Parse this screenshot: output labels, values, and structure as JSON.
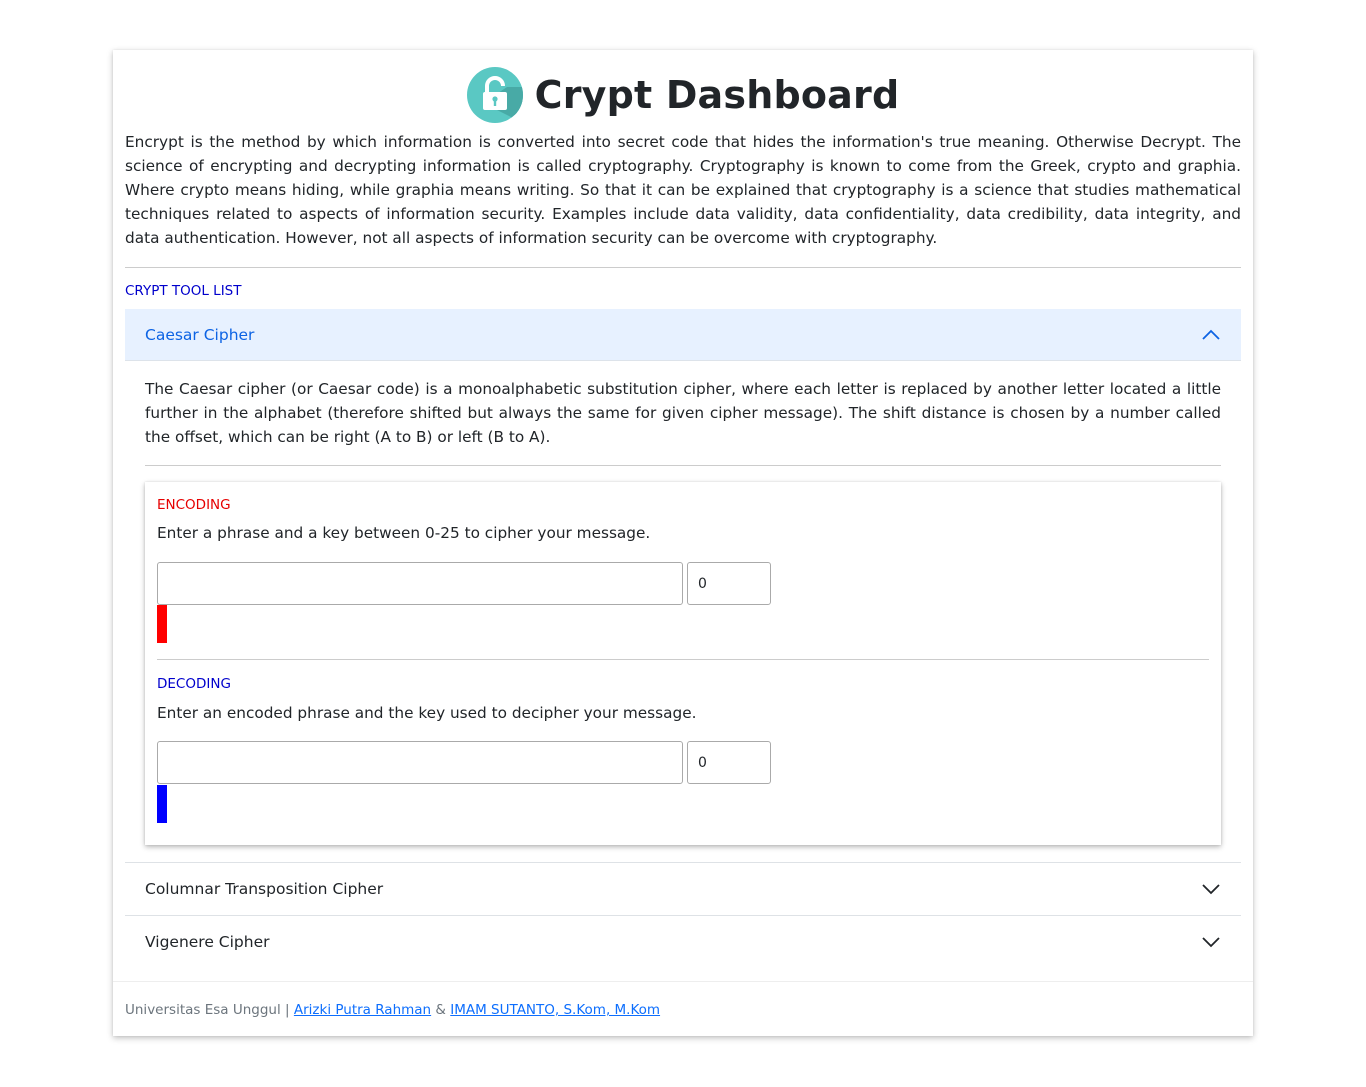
{
  "header": {
    "title": "Crypt Dashboard",
    "logo_icon": "padlock-icon",
    "logo_color": "#5ac8c3"
  },
  "intro": "Encrypt is the method by which information is converted into secret code that hides the information's true meaning. Otherwise Decrypt. The science of encrypting and decrypting information is called cryptography. Cryptography is known to come from the Greek, crypto and graphia. Where crypto means hiding, while graphia means writing. So that it can be explained that cryptography is a science that studies mathematical techniques related to aspects of information security. Examples include data validity, data confidentiality, data credibility, data integrity, and data authentication. However, not all aspects of information security can be overcome with cryptography.",
  "tool_list_label": "CRYPT TOOL LIST",
  "accordion": {
    "caesar": {
      "title": "Caesar Cipher",
      "expanded": true,
      "description": "The Caesar cipher (or Caesar code) is a monoalphabetic substitution cipher, where each letter is replaced by another letter located a little further in the alphabet (therefore shifted but always the same for given cipher message). The shift distance is chosen by a number called the offset, which can be right (A to B) or left (B to A).",
      "encoding": {
        "label": "ENCODING",
        "label_color": "#e60000",
        "description": "Enter a phrase and a key between 0-25 to cipher your message.",
        "phrase_value": "",
        "key_value": "0",
        "output_bar_color": "#ff0000"
      },
      "decoding": {
        "label": "DECODING",
        "label_color": "#0000cc",
        "description": "Enter an encoded phrase and the key used to decipher your message.",
        "phrase_value": "",
        "key_value": "0",
        "output_bar_color": "#0000ff"
      }
    },
    "columnar": {
      "title": "Columnar Transposition Cipher",
      "expanded": false
    },
    "vigenere": {
      "title": "Vigenere Cipher",
      "expanded": false
    }
  },
  "footer": {
    "org": "Universitas Esa Unggul",
    "separator": "|",
    "author1": "Arizki Putra Rahman",
    "amp": "&",
    "author2": "IMAM SUTANTO, S.Kom, M.Kom"
  },
  "colors": {
    "accent": "#0c63e4",
    "accordion_open_bg": "#e7f1ff"
  }
}
